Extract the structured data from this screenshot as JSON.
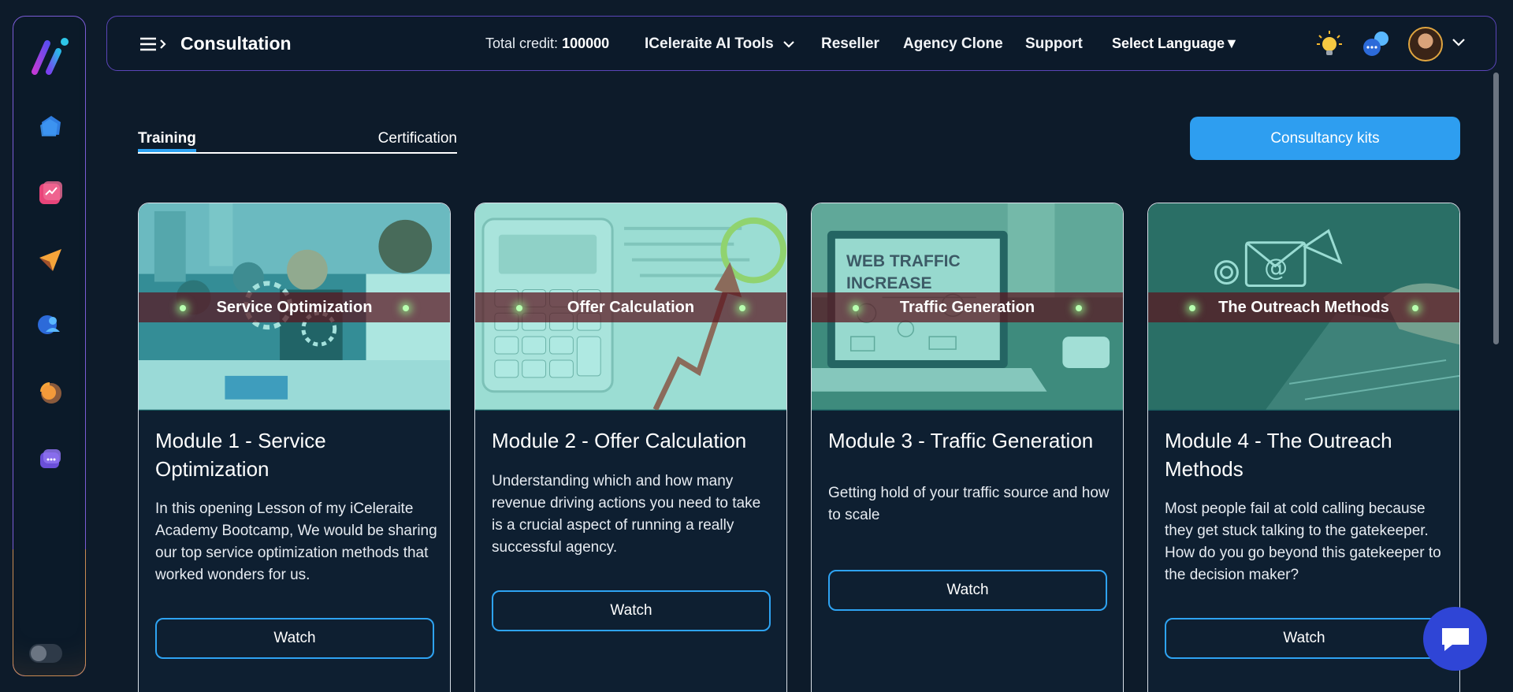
{
  "header": {
    "title": "Consultation",
    "credit_label": "Total credit:",
    "credit_value": "100000",
    "nav": {
      "tools": "ICeleraite AI Tools",
      "reseller": "Reseller",
      "agency_clone": "Agency Clone",
      "support": "Support"
    },
    "language": "Select Language▼"
  },
  "tabs": {
    "training": "Training",
    "certification": "Certification"
  },
  "kits_button": "Consultancy kits",
  "modules": [
    {
      "banner": "Service Optimization",
      "title": "Module 1 - Service Optimization",
      "description": "In this opening Lesson of my iCeleraite Academy Bootcamp, We would be sharing our top service optimization methods that worked wonders for us.",
      "watch": "Watch"
    },
    {
      "banner": "Offer Calculation",
      "title": "Module 2 - Offer Calculation",
      "description": "Understanding which and how many revenue driving actions you need to take is a crucial aspect of running a really successful agency.",
      "watch": "Watch"
    },
    {
      "banner": "Traffic Generation",
      "title": "Module 3 - Traffic Generation",
      "description": "Getting hold of your traffic source and how to scale",
      "watch": "Watch",
      "image_text": "WEB TRAFFIC INCREASE"
    },
    {
      "banner": "The Outreach Methods",
      "title": "Module 4 - The Outreach Methods",
      "description": "Most people fail at cold calling because they get stuck talking to the gatekeeper. How do you go beyond this gatekeeper to the decision maker?",
      "watch": "Watch"
    }
  ],
  "colors": {
    "accent": "#2ea3f2",
    "background": "#0d1b2a",
    "header_border": "#5a45b8"
  }
}
